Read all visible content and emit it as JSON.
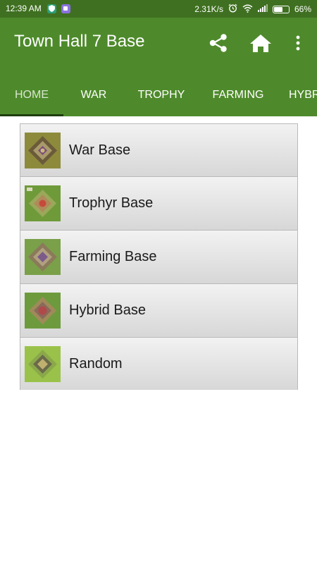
{
  "status_bar": {
    "time": "12:39 AM",
    "network_speed": "2.31K/s",
    "battery_percent": "66%",
    "battery_level": 0.66,
    "icons": [
      "shield-notification-icon",
      "app-notification-icon",
      "alarm-icon",
      "wifi-icon",
      "signal-icon",
      "battery-icon"
    ]
  },
  "app_bar": {
    "title": "Town Hall 7 Base",
    "actions": [
      "share-icon",
      "home-icon",
      "more-vert-icon"
    ]
  },
  "tabs": [
    {
      "label": "HOME",
      "active": true
    },
    {
      "label": "WAR",
      "active": false
    },
    {
      "label": "TROPHY",
      "active": false
    },
    {
      "label": "FARMING",
      "active": false
    },
    {
      "label": "HYBRID",
      "active": false
    }
  ],
  "list": {
    "items": [
      {
        "label": "War Base"
      },
      {
        "label": "Trophyr Base"
      },
      {
        "label": "Farming Base"
      },
      {
        "label": "Hybrid Base"
      },
      {
        "label": "Random"
      }
    ]
  },
  "colors": {
    "status_bar": "#3f7021",
    "app_bar": "#4e8a2b",
    "tab_indicator": "#1e3d0e"
  }
}
